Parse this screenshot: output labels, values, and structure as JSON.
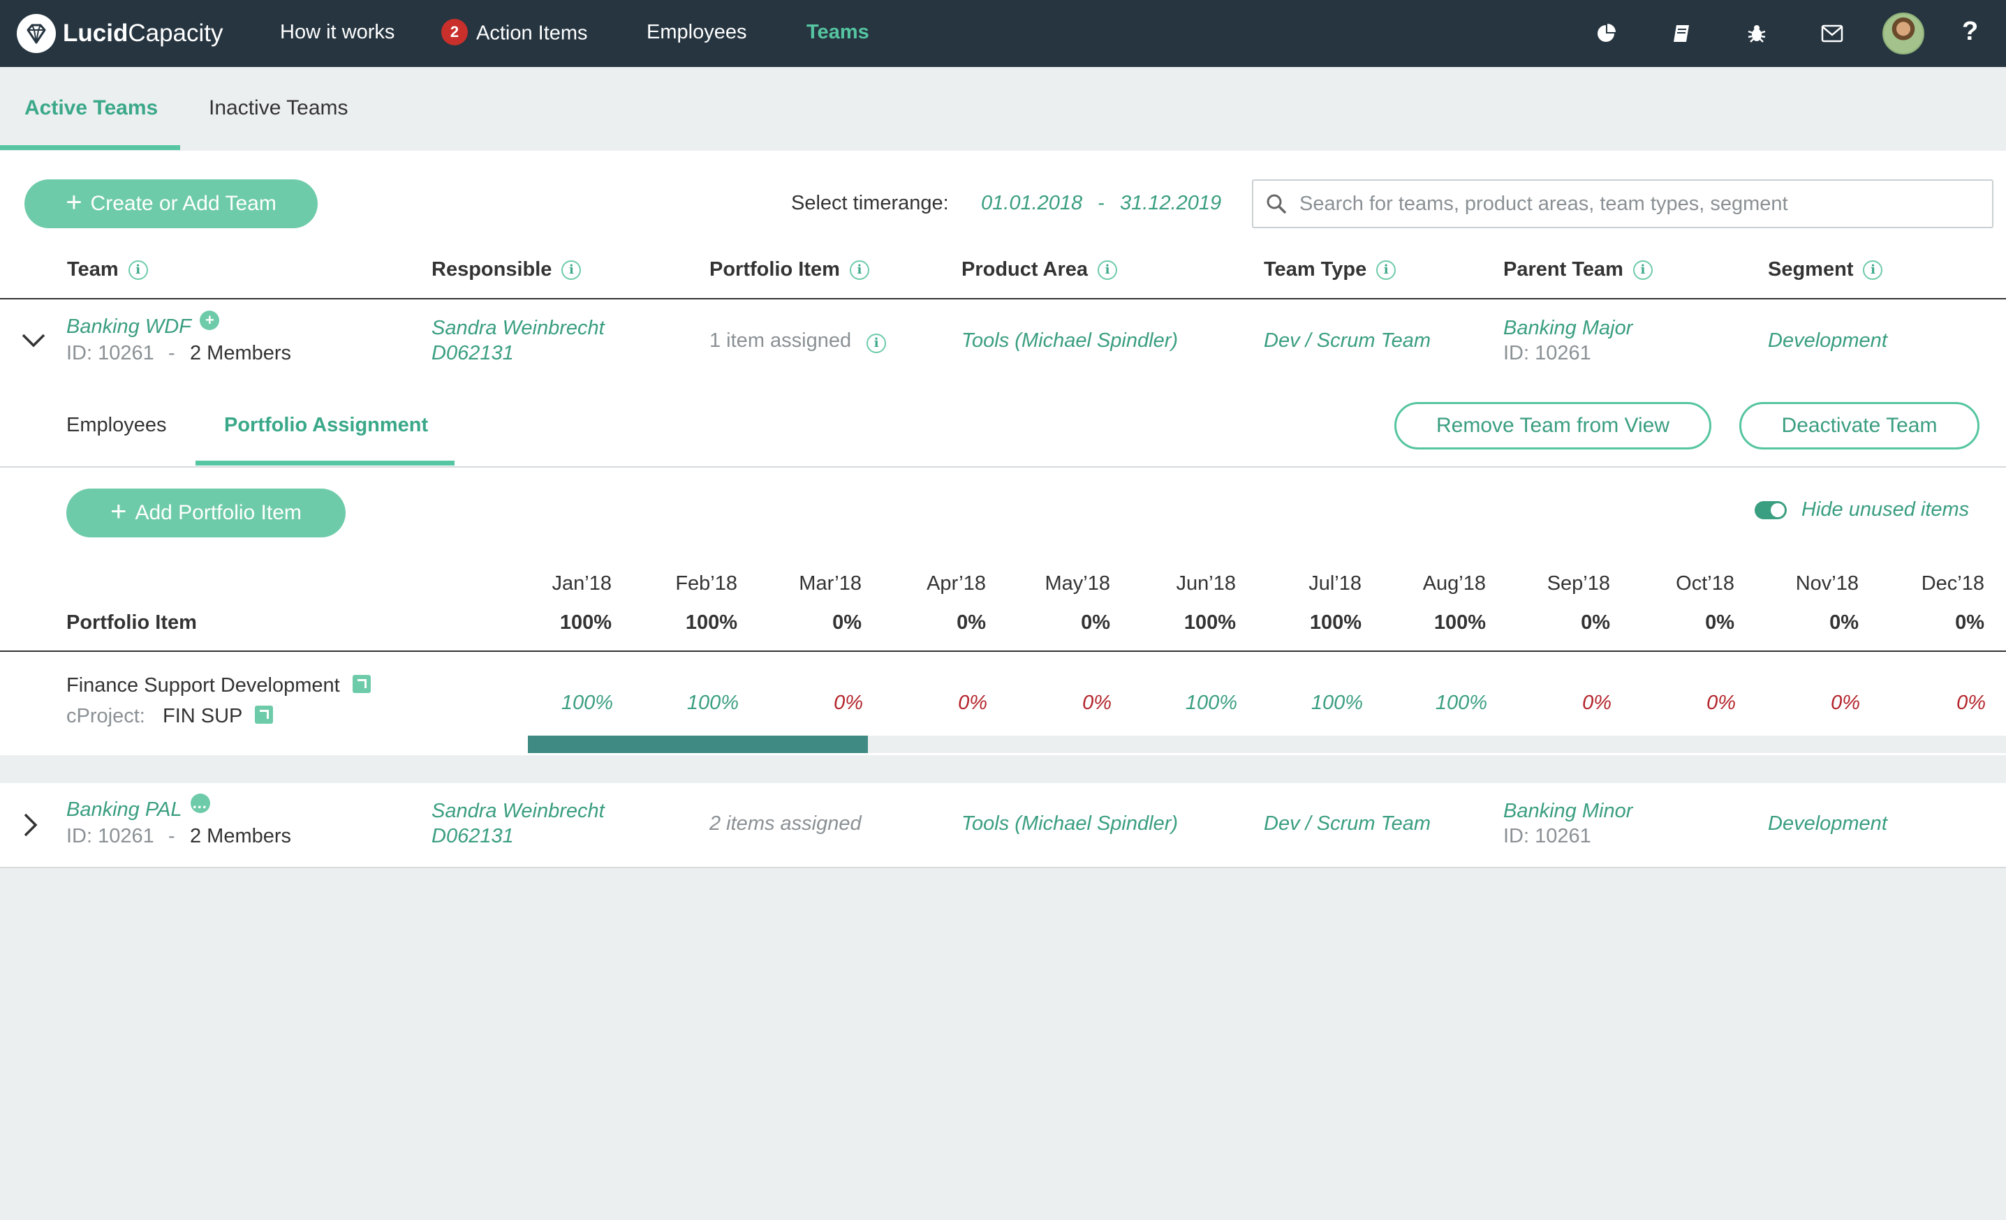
{
  "app": {
    "logo_bold": "Lucid",
    "logo_light": "Capacity",
    "nav": [
      {
        "label": "How it works"
      },
      {
        "label": "Action Items",
        "badge": "2"
      },
      {
        "label": "Employees"
      },
      {
        "label": "Teams"
      }
    ],
    "icons": [
      "pie-chart-icon",
      "book-icon",
      "bug-icon",
      "mail-icon",
      "avatar",
      "help-icon"
    ],
    "help_glyph": "?"
  },
  "subtabs": [
    "Active Teams",
    "Inactive Teams"
  ],
  "toolbar": {
    "create_label": "Create or Add Team",
    "timerange_label": "Select timerange:",
    "date_from": "01.01.2018",
    "date_sep": "-",
    "date_to": "31.12.2019",
    "search_placeholder": "Search for teams, product areas, team types, segment"
  },
  "columns": [
    "Team",
    "Responsible",
    "Portfolio Item",
    "Product Area",
    "Team Type",
    "Parent Team",
    "Segment"
  ],
  "teams": [
    {
      "name": "Banking WDF",
      "id": "ID: 10261",
      "id_sep": "-",
      "members": "2 Members",
      "responsible_name": "Sandra Weinbrecht",
      "responsible_id": "D062131",
      "portfolio": "1 item assigned",
      "product_area": "Tools (Michael Spindler)",
      "team_type": "Dev / Scrum Team",
      "parent_name": "Banking Major",
      "parent_id": "ID: 10261",
      "segment": "Development"
    },
    {
      "name": "Banking PAL",
      "id": "ID: 10261",
      "id_sep": "-",
      "members": "2 Members",
      "responsible_name": "Sandra Weinbrecht",
      "responsible_id": "D062131",
      "portfolio": "2 items assigned",
      "product_area": "Tools (Michael Spindler)",
      "team_type": "Dev / Scrum Team",
      "parent_name": "Banking Minor",
      "parent_id": "ID: 10261",
      "segment": "Development"
    }
  ],
  "detail": {
    "tabs": [
      "Employees",
      "Portfolio Assignment"
    ],
    "remove_label": "Remove Team from View",
    "deactivate_label": "Deactivate Team",
    "add_item_label": "Add Portfolio Item",
    "hide_unused_label": "Hide unused items",
    "hide_unused_on": true,
    "portfolio_col": "Portfolio Item",
    "months": [
      "Jan’18",
      "Feb’18",
      "Mar’18",
      "Apr’18",
      "May’18",
      "Jun’18",
      "Jul’18",
      "Aug’18",
      "Sep’18",
      "Oct’18",
      "Nov’18",
      "Dec’18"
    ],
    "totals": [
      "100%",
      "100%",
      "0%",
      "0%",
      "0%",
      "100%",
      "100%",
      "100%",
      "0%",
      "0%",
      "0%",
      "0%"
    ],
    "item": {
      "name": "Finance Support Development",
      "project_label": "cProject:",
      "project_code": "FIN SUP",
      "values": [
        "100%",
        "100%",
        "0%",
        "0%",
        "0%",
        "100%",
        "100%",
        "100%",
        "0%",
        "0%",
        "0%",
        "0%"
      ],
      "progress_fraction": 0.23
    }
  },
  "colors": {
    "nav_bg": "#263540",
    "accent": "#56c5a1",
    "accent_dark": "#3a9e80",
    "negative": "#b3242b",
    "bar": "#3f8a82"
  }
}
